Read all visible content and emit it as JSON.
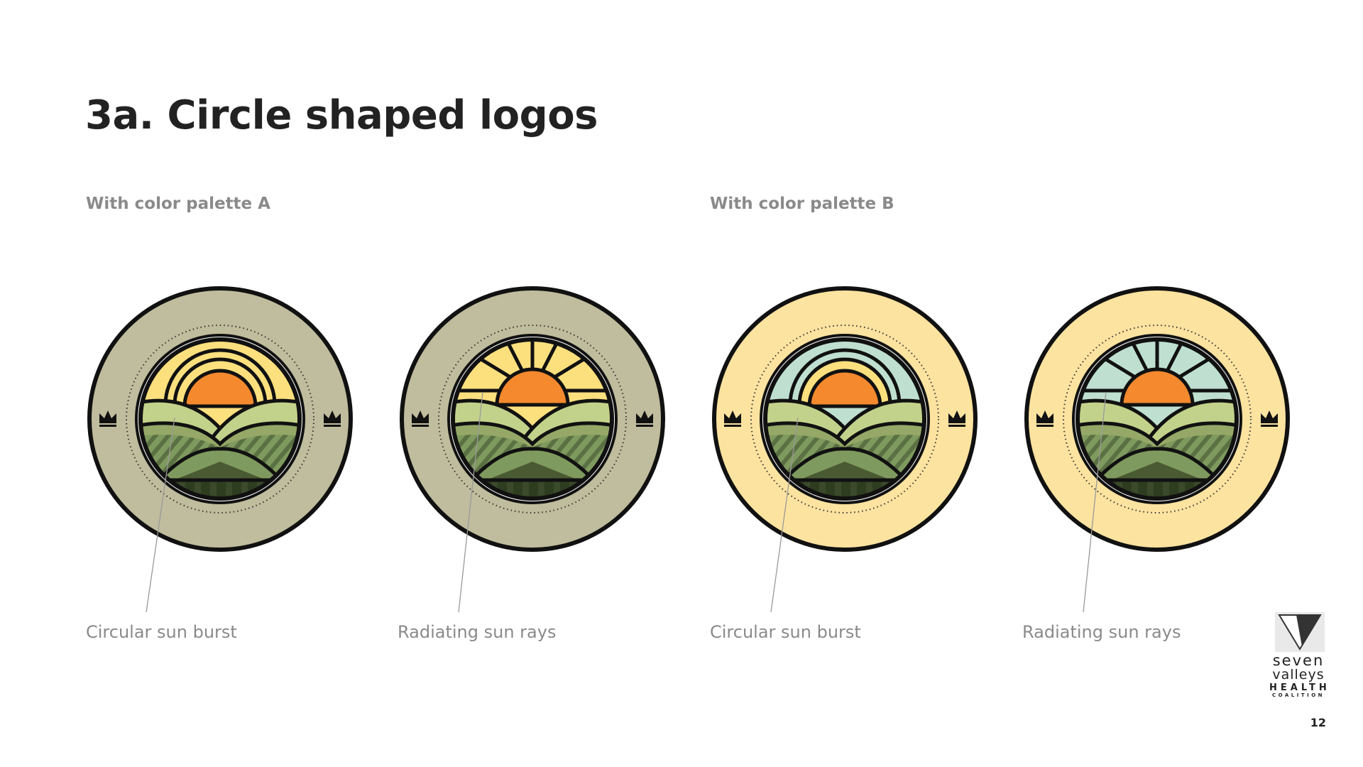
{
  "title": "3a. Circle shaped logos",
  "sections": [
    {
      "label": "With color palette A"
    },
    {
      "label": "With color palette B"
    }
  ],
  "palettes": {
    "A": {
      "ring": "#bfbd9d",
      "sky": "#fde07e",
      "rays": "#fde07e"
    },
    "B": {
      "ring": "#fde3a0",
      "sky": "#bfe0d0",
      "rays": "#fde07e"
    },
    "sun": "#f4892e",
    "hills": [
      "#c3d28b",
      "#95a867",
      "#7f9a5e",
      "#5b7043",
      "#2e3d20"
    ]
  },
  "logos": [
    {
      "palette": "A",
      "style": "burst",
      "caption": "Circular sun burst"
    },
    {
      "palette": "A",
      "style": "rays",
      "caption": "Radiating sun rays"
    },
    {
      "palette": "B",
      "style": "burst",
      "caption": "Circular sun burst"
    },
    {
      "palette": "B",
      "style": "rays",
      "caption": "Radiating sun rays"
    }
  ],
  "brand": {
    "line1": "seven",
    "line2": "valleys",
    "line3": "HEALTH",
    "line4": "COALITION"
  },
  "page_number": "12"
}
